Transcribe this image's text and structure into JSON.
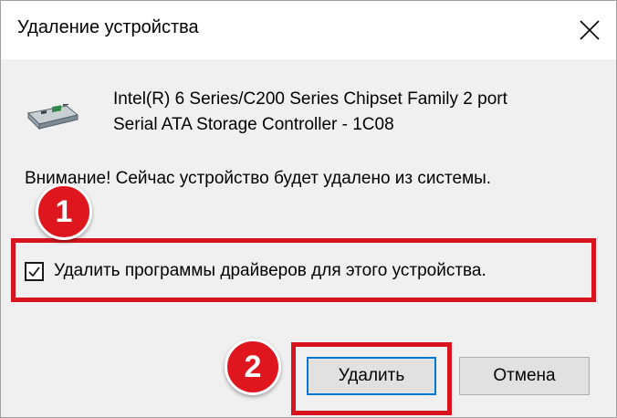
{
  "window": {
    "title": "Удаление устройства",
    "close_icon": "close-icon"
  },
  "device": {
    "icon": "storage-controller-icon",
    "name_line1": "Intel(R) 6 Series/C200 Series Chipset Family 2 port",
    "name_line2": "Serial ATA Storage Controller - 1C08"
  },
  "warning_text": "Внимание! Сейчас устройство будет удалено из системы.",
  "checkbox": {
    "label": "Удалить программы драйверов для этого устройства.",
    "checked": true
  },
  "annotations": {
    "badge1": "1",
    "badge2": "2",
    "highlight_color": "#d8141f"
  },
  "buttons": {
    "delete_label": "Удалить",
    "cancel_label": "Отмена"
  },
  "colors": {
    "focus_border": "#0078d7",
    "badge": "#e0161f"
  }
}
